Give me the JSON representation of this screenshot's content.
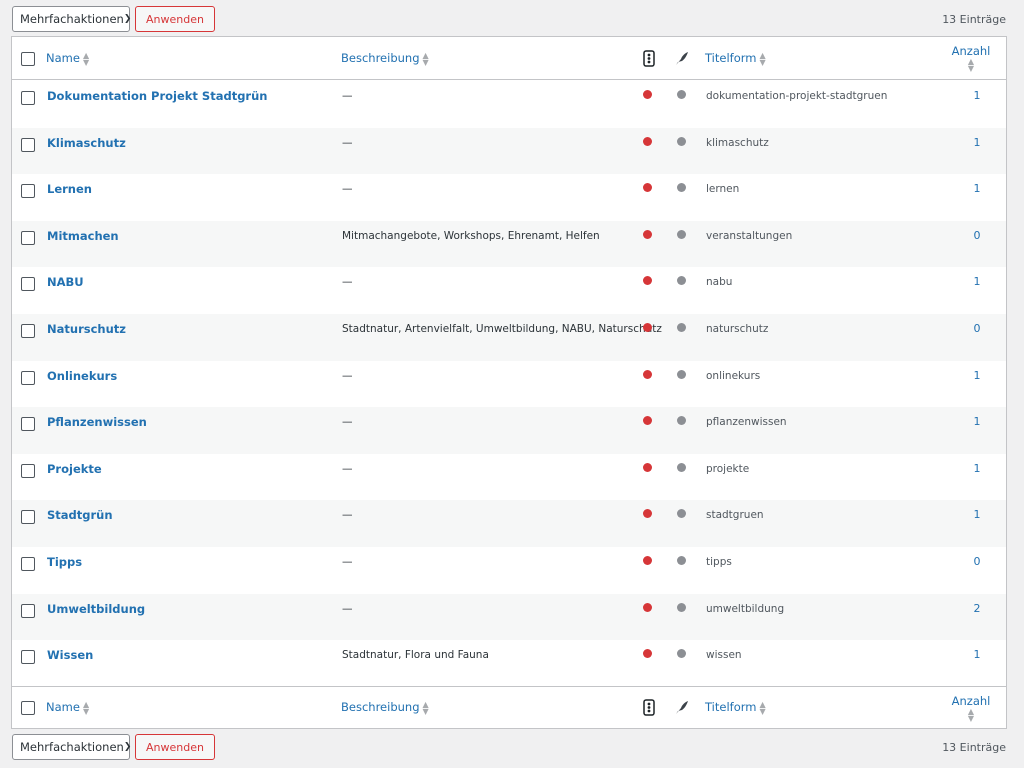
{
  "bulk_actions": {
    "label": "Mehrfachaktionen",
    "apply_label": "Anwenden"
  },
  "item_count": "13 Einträge",
  "columns": {
    "name": "Name",
    "description": "Beschreibung",
    "seo_icon": "traffic-light-icon",
    "readability_icon": "feather-icon",
    "slug": "Titelform",
    "count": "Anzahl"
  },
  "colors": {
    "accent": "#2271b1",
    "danger": "#d63638",
    "neutral": "#8c8f94"
  },
  "rows": [
    {
      "name": "Dokumentation Projekt Stadtgrün",
      "description": "—",
      "slug": "dokumentation-projekt-stadtgruen",
      "count": "1"
    },
    {
      "name": "Klimaschutz",
      "description": "—",
      "slug": "klimaschutz",
      "count": "1"
    },
    {
      "name": "Lernen",
      "description": "—",
      "slug": "lernen",
      "count": "1"
    },
    {
      "name": "Mitmachen",
      "description": "Mitmachangebote, Workshops, Ehrenamt, Helfen",
      "slug": "veranstaltungen",
      "count": "0"
    },
    {
      "name": "NABU",
      "description": "—",
      "slug": "nabu",
      "count": "1"
    },
    {
      "name": "Naturschutz",
      "description": "Stadtnatur, Artenvielfalt, Umweltbildung, NABU, Naturschutz",
      "slug": "naturschutz",
      "count": "0"
    },
    {
      "name": "Onlinekurs",
      "description": "—",
      "slug": "onlinekurs",
      "count": "1"
    },
    {
      "name": "Pflanzenwissen",
      "description": "—",
      "slug": "pflanzenwissen",
      "count": "1"
    },
    {
      "name": "Projekte",
      "description": "—",
      "slug": "projekte",
      "count": "1"
    },
    {
      "name": "Stadtgrün",
      "description": "—",
      "slug": "stadtgruen",
      "count": "1"
    },
    {
      "name": "Tipps",
      "description": "—",
      "slug": "tipps",
      "count": "0"
    },
    {
      "name": "Umweltbildung",
      "description": "—",
      "slug": "umweltbildung",
      "count": "2"
    },
    {
      "name": "Wissen",
      "description": "Stadtnatur, Flora und Fauna",
      "slug": "wissen",
      "count": "1"
    }
  ]
}
